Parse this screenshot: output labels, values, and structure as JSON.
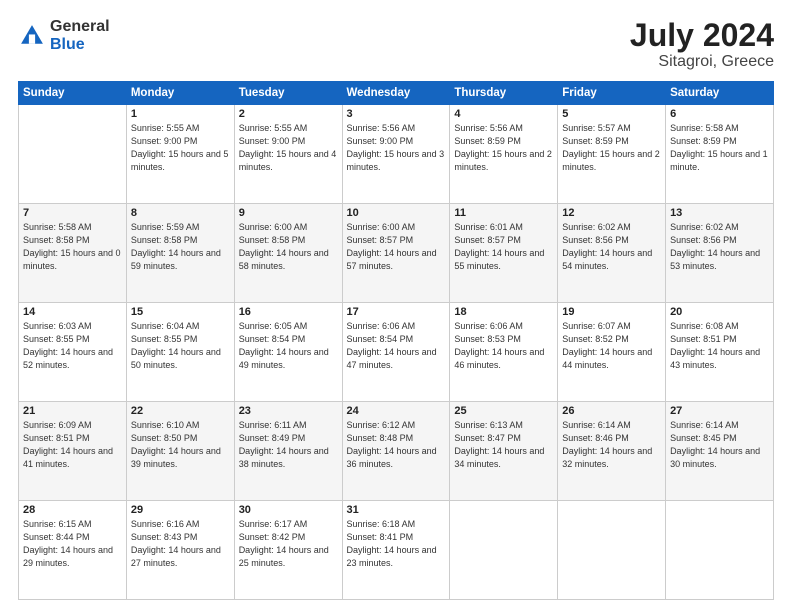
{
  "logo": {
    "general": "General",
    "blue": "Blue"
  },
  "title": {
    "month_year": "July 2024",
    "location": "Sitagroi, Greece"
  },
  "days_of_week": [
    "Sunday",
    "Monday",
    "Tuesday",
    "Wednesday",
    "Thursday",
    "Friday",
    "Saturday"
  ],
  "weeks": [
    [
      {
        "day": "",
        "sunrise": "",
        "sunset": "",
        "daylight": ""
      },
      {
        "day": "1",
        "sunrise": "Sunrise: 5:55 AM",
        "sunset": "Sunset: 9:00 PM",
        "daylight": "Daylight: 15 hours and 5 minutes."
      },
      {
        "day": "2",
        "sunrise": "Sunrise: 5:55 AM",
        "sunset": "Sunset: 9:00 PM",
        "daylight": "Daylight: 15 hours and 4 minutes."
      },
      {
        "day": "3",
        "sunrise": "Sunrise: 5:56 AM",
        "sunset": "Sunset: 9:00 PM",
        "daylight": "Daylight: 15 hours and 3 minutes."
      },
      {
        "day": "4",
        "sunrise": "Sunrise: 5:56 AM",
        "sunset": "Sunset: 8:59 PM",
        "daylight": "Daylight: 15 hours and 2 minutes."
      },
      {
        "day": "5",
        "sunrise": "Sunrise: 5:57 AM",
        "sunset": "Sunset: 8:59 PM",
        "daylight": "Daylight: 15 hours and 2 minutes."
      },
      {
        "day": "6",
        "sunrise": "Sunrise: 5:58 AM",
        "sunset": "Sunset: 8:59 PM",
        "daylight": "Daylight: 15 hours and 1 minute."
      }
    ],
    [
      {
        "day": "7",
        "sunrise": "Sunrise: 5:58 AM",
        "sunset": "Sunset: 8:58 PM",
        "daylight": "Daylight: 15 hours and 0 minutes."
      },
      {
        "day": "8",
        "sunrise": "Sunrise: 5:59 AM",
        "sunset": "Sunset: 8:58 PM",
        "daylight": "Daylight: 14 hours and 59 minutes."
      },
      {
        "day": "9",
        "sunrise": "Sunrise: 6:00 AM",
        "sunset": "Sunset: 8:58 PM",
        "daylight": "Daylight: 14 hours and 58 minutes."
      },
      {
        "day": "10",
        "sunrise": "Sunrise: 6:00 AM",
        "sunset": "Sunset: 8:57 PM",
        "daylight": "Daylight: 14 hours and 57 minutes."
      },
      {
        "day": "11",
        "sunrise": "Sunrise: 6:01 AM",
        "sunset": "Sunset: 8:57 PM",
        "daylight": "Daylight: 14 hours and 55 minutes."
      },
      {
        "day": "12",
        "sunrise": "Sunrise: 6:02 AM",
        "sunset": "Sunset: 8:56 PM",
        "daylight": "Daylight: 14 hours and 54 minutes."
      },
      {
        "day": "13",
        "sunrise": "Sunrise: 6:02 AM",
        "sunset": "Sunset: 8:56 PM",
        "daylight": "Daylight: 14 hours and 53 minutes."
      }
    ],
    [
      {
        "day": "14",
        "sunrise": "Sunrise: 6:03 AM",
        "sunset": "Sunset: 8:55 PM",
        "daylight": "Daylight: 14 hours and 52 minutes."
      },
      {
        "day": "15",
        "sunrise": "Sunrise: 6:04 AM",
        "sunset": "Sunset: 8:55 PM",
        "daylight": "Daylight: 14 hours and 50 minutes."
      },
      {
        "day": "16",
        "sunrise": "Sunrise: 6:05 AM",
        "sunset": "Sunset: 8:54 PM",
        "daylight": "Daylight: 14 hours and 49 minutes."
      },
      {
        "day": "17",
        "sunrise": "Sunrise: 6:06 AM",
        "sunset": "Sunset: 8:54 PM",
        "daylight": "Daylight: 14 hours and 47 minutes."
      },
      {
        "day": "18",
        "sunrise": "Sunrise: 6:06 AM",
        "sunset": "Sunset: 8:53 PM",
        "daylight": "Daylight: 14 hours and 46 minutes."
      },
      {
        "day": "19",
        "sunrise": "Sunrise: 6:07 AM",
        "sunset": "Sunset: 8:52 PM",
        "daylight": "Daylight: 14 hours and 44 minutes."
      },
      {
        "day": "20",
        "sunrise": "Sunrise: 6:08 AM",
        "sunset": "Sunset: 8:51 PM",
        "daylight": "Daylight: 14 hours and 43 minutes."
      }
    ],
    [
      {
        "day": "21",
        "sunrise": "Sunrise: 6:09 AM",
        "sunset": "Sunset: 8:51 PM",
        "daylight": "Daylight: 14 hours and 41 minutes."
      },
      {
        "day": "22",
        "sunrise": "Sunrise: 6:10 AM",
        "sunset": "Sunset: 8:50 PM",
        "daylight": "Daylight: 14 hours and 39 minutes."
      },
      {
        "day": "23",
        "sunrise": "Sunrise: 6:11 AM",
        "sunset": "Sunset: 8:49 PM",
        "daylight": "Daylight: 14 hours and 38 minutes."
      },
      {
        "day": "24",
        "sunrise": "Sunrise: 6:12 AM",
        "sunset": "Sunset: 8:48 PM",
        "daylight": "Daylight: 14 hours and 36 minutes."
      },
      {
        "day": "25",
        "sunrise": "Sunrise: 6:13 AM",
        "sunset": "Sunset: 8:47 PM",
        "daylight": "Daylight: 14 hours and 34 minutes."
      },
      {
        "day": "26",
        "sunrise": "Sunrise: 6:14 AM",
        "sunset": "Sunset: 8:46 PM",
        "daylight": "Daylight: 14 hours and 32 minutes."
      },
      {
        "day": "27",
        "sunrise": "Sunrise: 6:14 AM",
        "sunset": "Sunset: 8:45 PM",
        "daylight": "Daylight: 14 hours and 30 minutes."
      }
    ],
    [
      {
        "day": "28",
        "sunrise": "Sunrise: 6:15 AM",
        "sunset": "Sunset: 8:44 PM",
        "daylight": "Daylight: 14 hours and 29 minutes."
      },
      {
        "day": "29",
        "sunrise": "Sunrise: 6:16 AM",
        "sunset": "Sunset: 8:43 PM",
        "daylight": "Daylight: 14 hours and 27 minutes."
      },
      {
        "day": "30",
        "sunrise": "Sunrise: 6:17 AM",
        "sunset": "Sunset: 8:42 PM",
        "daylight": "Daylight: 14 hours and 25 minutes."
      },
      {
        "day": "31",
        "sunrise": "Sunrise: 6:18 AM",
        "sunset": "Sunset: 8:41 PM",
        "daylight": "Daylight: 14 hours and 23 minutes."
      },
      {
        "day": "",
        "sunrise": "",
        "sunset": "",
        "daylight": ""
      },
      {
        "day": "",
        "sunrise": "",
        "sunset": "",
        "daylight": ""
      },
      {
        "day": "",
        "sunrise": "",
        "sunset": "",
        "daylight": ""
      }
    ]
  ]
}
